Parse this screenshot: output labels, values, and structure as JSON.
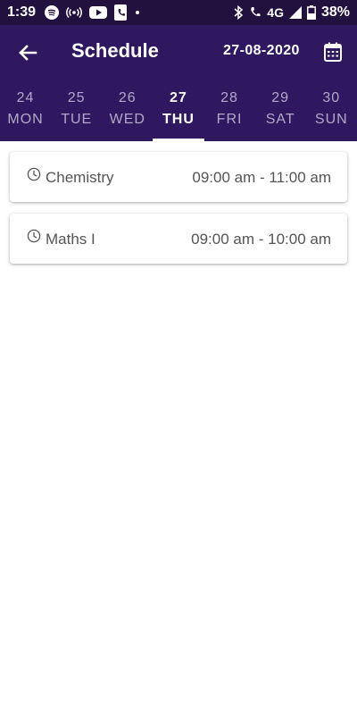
{
  "status_bar": {
    "time": "1:39",
    "network": "4G",
    "battery_percent": "38%"
  },
  "app_bar": {
    "title": "Schedule",
    "date": "27-08-2020",
    "back_icon": "arrow-left-icon",
    "calendar_icon": "calendar-icon"
  },
  "days": [
    {
      "num": "24",
      "name": "MON",
      "active": false
    },
    {
      "num": "25",
      "name": "TUE",
      "active": false
    },
    {
      "num": "26",
      "name": "WED",
      "active": false
    },
    {
      "num": "27",
      "name": "THU",
      "active": true
    },
    {
      "num": "28",
      "name": "FRI",
      "active": false
    },
    {
      "num": "29",
      "name": "SAT",
      "active": false
    },
    {
      "num": "30",
      "name": "SUN",
      "active": false
    }
  ],
  "schedule": [
    {
      "subject": "Chemistry",
      "time": "09:00 am - 11:00 am",
      "icon": "clock-icon"
    },
    {
      "subject": "Maths I",
      "time": "09:00 am - 10:00 am",
      "icon": "clock-icon"
    }
  ],
  "colors": {
    "status_bar_bg": "#22103f",
    "app_bar_bg": "#2f185f",
    "inactive_tab_text": "#b2a8c8",
    "active_tab_text": "#ffffff",
    "card_text": "#555555"
  }
}
